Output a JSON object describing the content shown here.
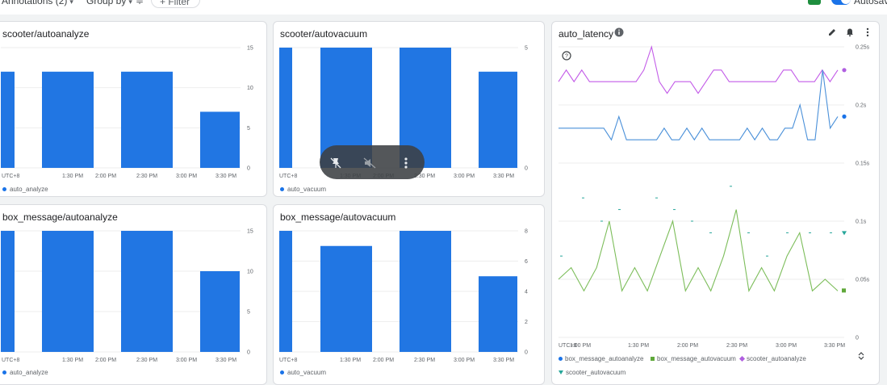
{
  "toolbar": {
    "annotations_label": "Annotations (2)",
    "group_by_label": "Group by",
    "filter_label": "Filter",
    "autosave_label": "Autosave"
  },
  "panels": {
    "p1": {
      "title": "scooter/autoanalyze",
      "legend": "auto_analyze"
    },
    "p2": {
      "title": "scooter/autovacuum",
      "legend": "auto_vacuum"
    },
    "p3": {
      "title": "box_message/autoanalyze",
      "legend": "auto_analyze"
    },
    "p4": {
      "title": "box_message/autovacuum",
      "legend": "auto_vacuum"
    },
    "p5": {
      "title": "auto_latency"
    }
  },
  "latency_legend": {
    "s1": "box_message_autoanalyze",
    "s2": "box_message_autovacuum",
    "s3": "scooter_autoanalyze",
    "s4": "scooter_autovacuum"
  },
  "colors": {
    "bar": "#2176e3",
    "magenta": "#c35ce8",
    "blue_line": "#4a90d9",
    "green": "#7cbd5a",
    "teal": "#26a69a",
    "axis_text": "#5f6368"
  },
  "icons": [
    "chevron-down-icon",
    "sort-icon",
    "plus-icon",
    "edit-icon",
    "alert-bell-icon",
    "more-vert-icon",
    "info-icon",
    "help-icon",
    "unpin-icon",
    "mute-icon",
    "expand-icon"
  ],
  "chart_data": [
    {
      "type": "bar",
      "title": "scooter/autoanalyze",
      "x_ticks": [
        "UTC+8",
        "1:30 PM",
        "2:00 PM",
        "2:30 PM",
        "3:00 PM",
        "3:30 PM"
      ],
      "y_ticks": [
        "15",
        "10",
        "5",
        "0"
      ],
      "ylim": [
        0,
        15
      ],
      "series": [
        {
          "name": "auto_analyze",
          "values": [
            12,
            12,
            12,
            7
          ]
        }
      ]
    },
    {
      "type": "bar",
      "title": "scooter/autovacuum",
      "x_ticks": [
        "UTC+8",
        "1:30 PM",
        "2:00 PM",
        "2:30 PM",
        "3:00 PM",
        "3:30 PM"
      ],
      "y_ticks": [
        "5",
        "0"
      ],
      "ylim": [
        0,
        5
      ],
      "series": [
        {
          "name": "auto_vacuum",
          "values": [
            5,
            5,
            5,
            4
          ]
        }
      ]
    },
    {
      "type": "bar",
      "title": "box_message/autoanalyze",
      "x_ticks": [
        "UTC+8",
        "1:30 PM",
        "2:00 PM",
        "2:30 PM",
        "3:00 PM",
        "3:30 PM"
      ],
      "y_ticks": [
        "15",
        "10",
        "5",
        "0"
      ],
      "ylim": [
        0,
        15
      ],
      "series": [
        {
          "name": "auto_analyze",
          "values": [
            15,
            15,
            15,
            10
          ]
        }
      ]
    },
    {
      "type": "bar",
      "title": "box_message/autovacuum",
      "x_ticks": [
        "UTC+8",
        "1:30 PM",
        "2:00 PM",
        "2:30 PM",
        "3:00 PM",
        "3:30 PM"
      ],
      "y_ticks": [
        "8",
        "6",
        "4",
        "2",
        "0"
      ],
      "ylim": [
        0,
        8
      ],
      "series": [
        {
          "name": "auto_vacuum",
          "values": [
            8,
            7,
            8,
            5
          ]
        }
      ]
    },
    {
      "type": "line",
      "title": "auto_latency",
      "x_ticks": [
        "UTC+8",
        "1:00 PM",
        "1:30 PM",
        "2:00 PM",
        "2:30 PM",
        "3:00 PM",
        "3:30 PM"
      ],
      "y_ticks": [
        "0.25s",
        "0.2s",
        "0.15s",
        "0.1s",
        "0.05s",
        "0"
      ],
      "ylim": [
        0,
        0.25
      ],
      "series": [
        {
          "name": "scooter_autoanalyze",
          "values": [
            0.22,
            0.23,
            0.22,
            0.23,
            0.22,
            0.22,
            0.22,
            0.22,
            0.22,
            0.22,
            0.22,
            0.23,
            0.25,
            0.22,
            0.21,
            0.22,
            0.22,
            0.22,
            0.21,
            0.22,
            0.23,
            0.23,
            0.22,
            0.22,
            0.22,
            0.22,
            0.22,
            0.22,
            0.22,
            0.23,
            0.23,
            0.22,
            0.22,
            0.22,
            0.23,
            0.22,
            0.23
          ]
        },
        {
          "name": "box_message_autoanalyze",
          "values": [
            0.18,
            0.18,
            0.18,
            0.18,
            0.18,
            0.18,
            0.18,
            0.17,
            0.19,
            0.17,
            0.17,
            0.17,
            0.17,
            0.17,
            0.18,
            0.17,
            0.17,
            0.18,
            0.17,
            0.18,
            0.17,
            0.17,
            0.17,
            0.17,
            0.17,
            0.18,
            0.17,
            0.18,
            0.17,
            0.17,
            0.18,
            0.18,
            0.2,
            0.17,
            0.17,
            0.23,
            0.18,
            0.19
          ]
        },
        {
          "name": "box_message_autovacuum",
          "values": [
            0.05,
            0.06,
            0.04,
            0.06,
            0.1,
            0.04,
            0.06,
            0.04,
            0.07,
            0.1,
            0.04,
            0.06,
            0.04,
            0.07,
            0.11,
            0.04,
            0.06,
            0.04,
            0.07,
            0.09,
            0.04,
            0.05,
            0.04
          ]
        },
        {
          "name": "scooter_autovacuum",
          "values": []
        }
      ]
    }
  ]
}
